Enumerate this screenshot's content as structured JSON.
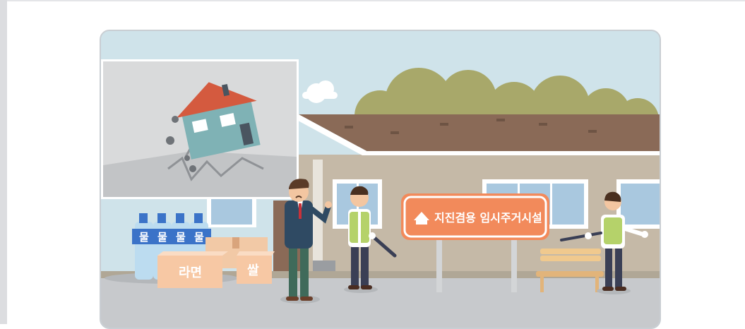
{
  "scene": {
    "sign_text": "지진겸용 임시주거시설",
    "water_label": "물",
    "ramen_label": "라면",
    "rice_label": "쌀"
  },
  "colors": {
    "sky": "#cfe3ea",
    "roof": "#8a6a57",
    "wall": "#c5b9a7",
    "sign": "#f28a5b",
    "ground": "#c7c9cc",
    "vest": "#b5d26a"
  }
}
